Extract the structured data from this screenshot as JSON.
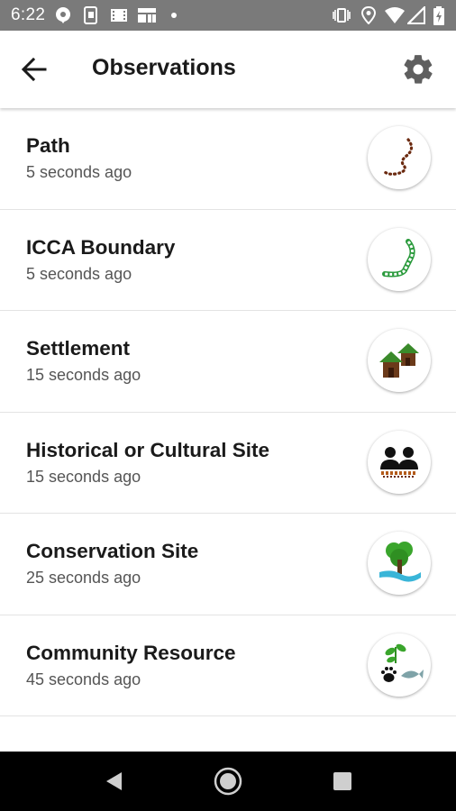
{
  "status_bar": {
    "time": "6:22",
    "left_icons": [
      "chat-bubble-icon",
      "screenshot-icon",
      "film-icon",
      "grid-icon",
      "dot-icon"
    ],
    "right_icons": [
      "vibrate-icon",
      "location-icon",
      "wifi-icon",
      "signal-icon",
      "battery-icon"
    ]
  },
  "app_bar": {
    "title": "Observations",
    "back_icon": "arrow-back-icon",
    "settings_icon": "gear-icon"
  },
  "observations": [
    {
      "name": "Path",
      "time": "5 seconds ago",
      "icon": "path-icon"
    },
    {
      "name": "ICCA Boundary",
      "time": "5 seconds ago",
      "icon": "boundary-icon"
    },
    {
      "name": "Settlement",
      "time": "15 seconds ago",
      "icon": "houses-icon"
    },
    {
      "name": "Historical or Cultural Site",
      "time": "15 seconds ago",
      "icon": "people-icon"
    },
    {
      "name": "Conservation Site",
      "time": "25 seconds ago",
      "icon": "tree-icon"
    },
    {
      "name": "Community Resource",
      "time": "45 seconds ago",
      "icon": "resource-icon"
    }
  ],
  "nav_bar": {
    "back": "nav-back-icon",
    "home": "nav-home-icon",
    "recents": "nav-recents-icon"
  },
  "colors": {
    "status_bar": "#7a7a7a",
    "path_brown": "#6b2a10",
    "boundary_green": "#2a9a3c",
    "roof_green": "#3a8a2a",
    "house_brown": "#6b3a1a",
    "water_blue": "#39b5d8",
    "tree_green": "#3aa52c"
  }
}
